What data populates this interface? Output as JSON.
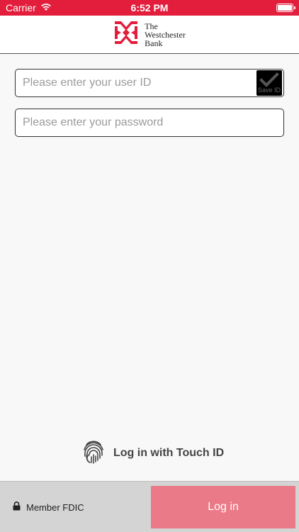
{
  "status_bar": {
    "carrier": "Carrier",
    "time": "6:52 PM"
  },
  "header": {
    "logo_line1": "The",
    "logo_line2": "Westchester",
    "logo_line3": "Bank",
    "brand_color": "#e31d3c"
  },
  "form": {
    "userid_placeholder": "Please enter your user ID",
    "userid_value": "",
    "password_placeholder": "Please enter your password",
    "password_value": "",
    "save_id_label": "Save ID",
    "save_id_checked": true
  },
  "touch_id": {
    "label": "Log in with Touch ID",
    "icon": "fingerprint-icon"
  },
  "footer": {
    "fdic_label": "Member FDIC",
    "fdic_icon": "lock-icon",
    "login_label": "Log in",
    "login_color": "#ea7a87"
  }
}
